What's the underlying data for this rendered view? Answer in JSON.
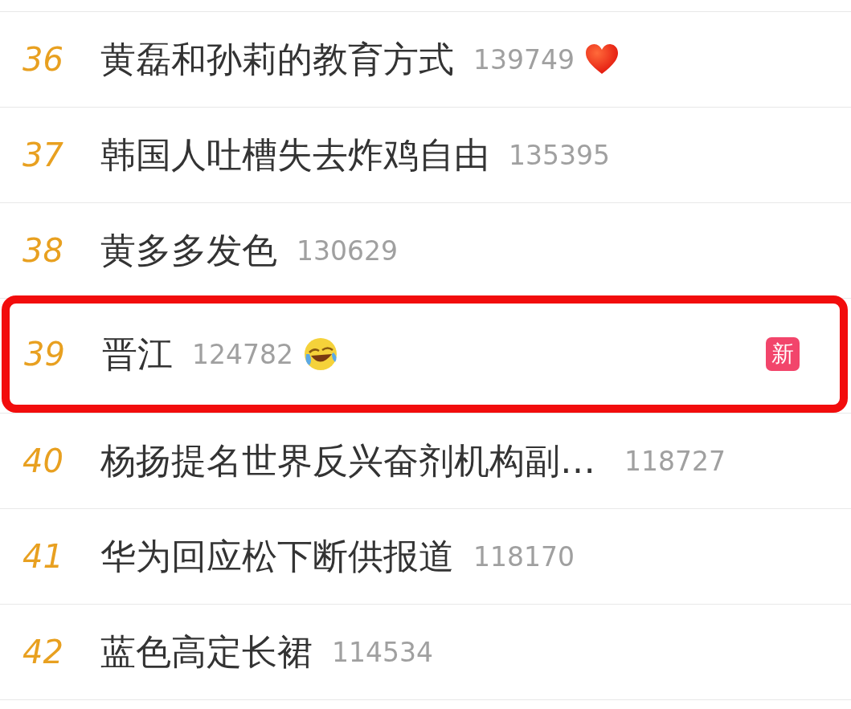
{
  "rows": [
    {
      "rank": "36",
      "title": "黄磊和孙莉的教育方式",
      "count": "139749",
      "kind": "heart",
      "highlighted": false
    },
    {
      "rank": "37",
      "title": "韩国人吐槽失去炸鸡自由",
      "count": "135395",
      "highlighted": false
    },
    {
      "rank": "38",
      "title": "黄多多发色",
      "count": "130629",
      "highlighted": false
    },
    {
      "rank": "39",
      "title": "晋江",
      "count": "124782",
      "kind": "laugh",
      "badge": "新",
      "highlighted": true
    },
    {
      "rank": "40",
      "title": "杨扬提名世界反兴奋剂机构副…",
      "count": "118727",
      "highlighted": false
    },
    {
      "rank": "41",
      "title": "华为回应松下断供报道",
      "count": "118170",
      "highlighted": false
    },
    {
      "rank": "42",
      "title": "蓝色高定长裙",
      "count": "114534",
      "highlighted": false
    }
  ]
}
